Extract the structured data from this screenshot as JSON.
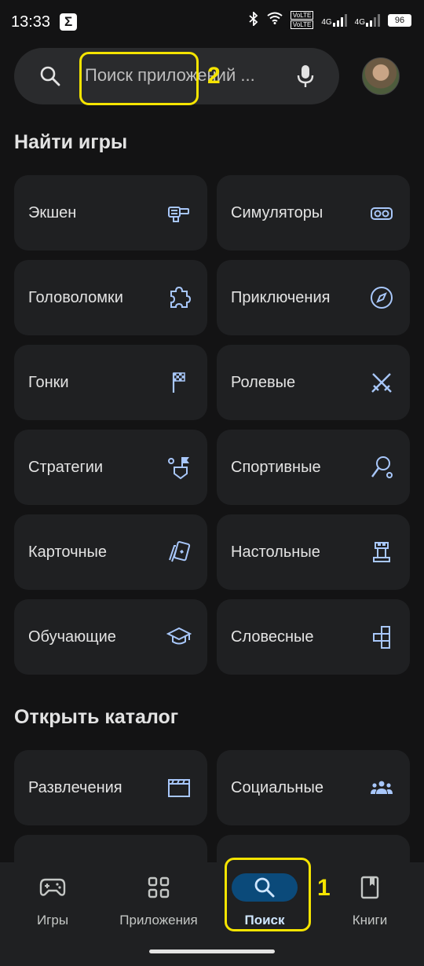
{
  "status_bar": {
    "time": "13:33",
    "app_badge": "Σ",
    "network_badge_1": "VoLTE",
    "network_badge_2": "VoLTE",
    "net_type_1": "4G",
    "net_type_2": "4G",
    "battery": "96"
  },
  "search": {
    "placeholder": "Поиск приложений ..."
  },
  "annotations": {
    "label_search": "2",
    "label_nav": "1",
    "color": "#f5e400"
  },
  "games_section": {
    "title": "Найти игры",
    "tiles": [
      {
        "label": "Экшен",
        "icon": "action-icon"
      },
      {
        "label": "Симуляторы",
        "icon": "vr-headset-icon"
      },
      {
        "label": "Головоломки",
        "icon": "puzzle-icon"
      },
      {
        "label": "Приключения",
        "icon": "compass-icon"
      },
      {
        "label": "Гонки",
        "icon": "checkered-flag-icon"
      },
      {
        "label": "Ролевые",
        "icon": "crossed-swords-icon"
      },
      {
        "label": "Стратегии",
        "icon": "strategy-flag-icon"
      },
      {
        "label": "Спортивные",
        "icon": "racket-icon"
      },
      {
        "label": "Карточные",
        "icon": "cards-icon"
      },
      {
        "label": "Настольные",
        "icon": "chess-rook-icon"
      },
      {
        "label": "Обучающие",
        "icon": "graduation-cap-icon"
      },
      {
        "label": "Словесные",
        "icon": "letter-blocks-icon"
      }
    ]
  },
  "catalog_section": {
    "title": "Открыть каталог",
    "tiles": [
      {
        "label": "Развлечения",
        "icon": "clapperboard-icon"
      },
      {
        "label": "Социальные",
        "icon": "people-icon"
      }
    ]
  },
  "bottom_nav": {
    "items": [
      {
        "label": "Игры",
        "icon": "gamepad-icon",
        "active": false
      },
      {
        "label": "Приложения",
        "icon": "apps-grid-icon",
        "active": false
      },
      {
        "label": "Поиск",
        "icon": "search-icon",
        "active": true
      },
      {
        "label": "Книги",
        "icon": "book-icon",
        "active": false
      }
    ]
  },
  "colors": {
    "background": "#131314",
    "tile": "#1f2022",
    "icon_accent": "#a8c7fa",
    "active_pill": "#0b4a7a"
  }
}
